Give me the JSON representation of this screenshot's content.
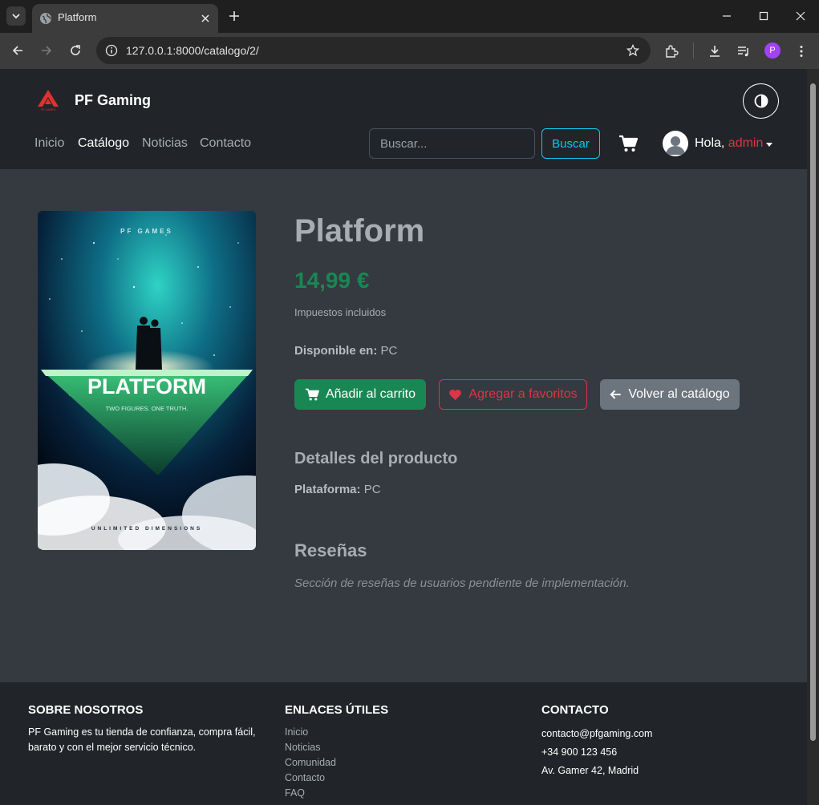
{
  "browser": {
    "tab_title": "Platform",
    "url": "127.0.0.1:8000/catalogo/2/",
    "profile_initial": "P"
  },
  "site": {
    "brand": "PF Gaming",
    "logo_caption": "PF GAMES",
    "nav": [
      "Inicio",
      "Catálogo",
      "Noticias",
      "Contacto"
    ],
    "active_nav": "Catálogo",
    "search_placeholder": "Buscar...",
    "search_button": "Buscar",
    "greeting": "Hola, ",
    "username": "admin"
  },
  "product": {
    "title": "Platform",
    "price": "14,99 €",
    "tax_note": "Impuestos incluidos",
    "availability_label": "Disponible en:",
    "availability_value": "PC",
    "add_to_cart": "Añadir al carrito",
    "add_to_favorites": "Agregar a favoritos",
    "back_to_catalog": "Volver al catálogo",
    "details_heading": "Detalles del producto",
    "platform_label": "Plataforma:",
    "platform_value": "PC",
    "reviews_heading": "Reseñas",
    "reviews_note": "Sección de reseñas de usuarios pendiente de implementación.",
    "cover": {
      "top_text": "PF GAMES",
      "title_text": "PLATFORM",
      "tagline": "TWO FIGURES. ONE TRUTH.",
      "bottom_text": "UNLIMITED DIMENSIONS"
    }
  },
  "footer": {
    "about_heading": "SOBRE NOSOTROS",
    "about_text": "PF Gaming es tu tienda de confianza, compra fácil, barato y con el mejor servicio técnico.",
    "links_heading": "ENLACES ÚTILES",
    "links": [
      "Inicio",
      "Noticias",
      "Comunidad",
      "Contacto",
      "FAQ"
    ],
    "contact_heading": "CONTACTO",
    "contact": [
      "contacto@pfgaming.com",
      "+34 900 123 456",
      "Av. Gamer 42, Madrid"
    ]
  },
  "colors": {
    "header_bg": "#212529",
    "page_bg": "#343a40",
    "price_green": "#198754",
    "danger_red": "#dc3545",
    "info_cyan": "#0dcaf0",
    "secondary_gray": "#6c757d"
  }
}
